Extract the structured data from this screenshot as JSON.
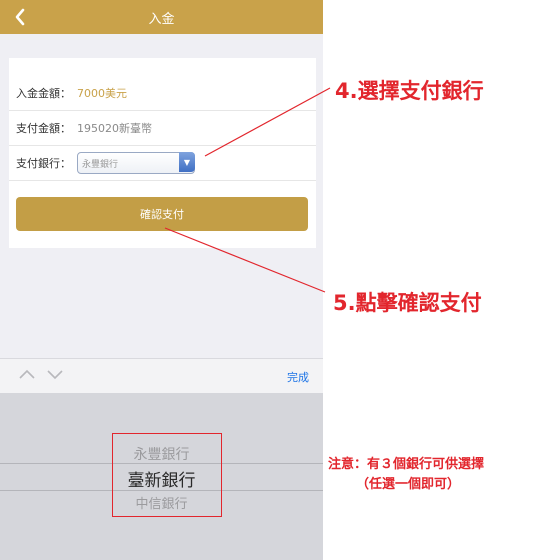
{
  "navbar": {
    "title": "入金"
  },
  "form": {
    "deposit_label": "入金金額：",
    "deposit_value": "7000美元",
    "pay_label": "支付金額：",
    "pay_value": "195020新臺幣",
    "bank_label": "支付銀行：",
    "bank_value": "永豐銀行",
    "confirm_label": "確認支付"
  },
  "toolbar": {
    "done_label": "完成"
  },
  "picker": {
    "options": [
      "永豐銀行",
      "臺新銀行",
      "中信銀行"
    ],
    "selected": "臺新銀行"
  },
  "annotations": {
    "step4": "4.選擇支付銀行",
    "step5": "5.點擊確認支付",
    "note_line1": "注意：有３個銀行可供選擇",
    "note_line2": "（任選一個即可）"
  },
  "colors": {
    "accent_gold": "#c9a24a",
    "annotation_red": "#e2262d",
    "link_blue": "#1e74e6"
  }
}
